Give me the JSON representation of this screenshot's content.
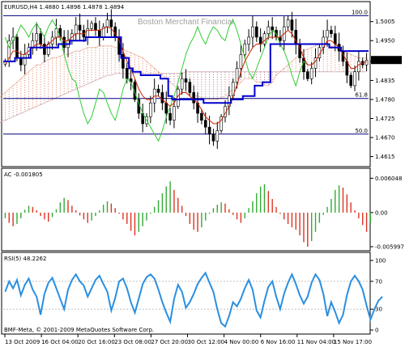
{
  "window": {
    "symbol_header": "EURUSD,H4  1.4880 1.4896 1.4878 1.4894",
    "watermark": "Boston Merchant Financial",
    "footer": "BMF-Meta, © 2001-2009 MetaQuotes Software Corp."
  },
  "colors": {
    "candle": "#000000",
    "kijun": "#0000cc",
    "tenkan": "#cc2200",
    "chikou": "#33cc33",
    "cloud": "#e08060",
    "cloud_shade": "#b07080",
    "fib": "#000080",
    "ac_up": "#33aa33",
    "ac_down": "#dd3322",
    "rsi": "#2a8fe0",
    "grid": "#c0c0c0"
  },
  "chart_data": [
    {
      "type": "candlestick",
      "title": "EURUSD,H4",
      "ohlc_last": {
        "open": 1.488,
        "high": 1.4896,
        "low": 1.4878,
        "close": 1.4894
      },
      "y_ticks": [
        "1.5005",
        "1.4950",
        "1.4890",
        "1.4835",
        "1.4780",
        "1.4725",
        "1.4670",
        "1.4615"
      ],
      "ylim": [
        1.46,
        1.503
      ],
      "current_price": "1.4894",
      "fib_levels": [
        {
          "label": "100.0",
          "value": 1.5022
        },
        {
          "label": "61.8",
          "value": 1.4783
        },
        {
          "label": "50.0",
          "value": 1.468
        }
      ],
      "close": [
        1.489,
        1.495,
        1.496,
        1.49,
        1.488,
        1.491,
        1.493,
        1.495,
        1.497,
        1.494,
        1.491,
        1.494,
        1.496,
        1.4985,
        1.496,
        1.493,
        1.495,
        1.497,
        1.4995,
        1.498,
        1.496,
        1.4985,
        1.5,
        1.498,
        1.496,
        1.499,
        1.501,
        1.499,
        1.496,
        1.491,
        1.487,
        1.484,
        1.483,
        1.478,
        1.474,
        1.471,
        1.473,
        1.477,
        1.481,
        1.48,
        1.477,
        1.474,
        1.472,
        1.476,
        1.481,
        1.484,
        1.483,
        1.48,
        1.477,
        1.474,
        1.472,
        1.47,
        1.468,
        1.466,
        1.469,
        1.473,
        1.476,
        1.479,
        1.483,
        1.487,
        1.491,
        1.494,
        1.496,
        1.499,
        1.496,
        1.494,
        1.497,
        1.499,
        1.498,
        1.496,
        1.495,
        1.499,
        1.501,
        1.498,
        1.494,
        1.49,
        1.486,
        1.484,
        1.487,
        1.49,
        1.493,
        1.496,
        1.498,
        1.497,
        1.494,
        1.492,
        1.489,
        1.485,
        1.482,
        1.486,
        1.489,
        1.488,
        1.4894
      ],
      "kijun": [
        1.489,
        1.489,
        1.489,
        1.49,
        1.49,
        1.49,
        1.49,
        1.493,
        1.493,
        1.493,
        1.493,
        1.493,
        1.493,
        1.493,
        1.494,
        1.494,
        1.494,
        1.495,
        1.495,
        1.495,
        1.495,
        1.496,
        1.496,
        1.496,
        1.496,
        1.496,
        1.496,
        1.496,
        1.496,
        1.496,
        1.49,
        1.49,
        1.487,
        1.486,
        1.486,
        1.485,
        1.485,
        1.485,
        1.485,
        1.485,
        1.484,
        1.484,
        1.479,
        1.478,
        1.478,
        1.478,
        1.478,
        1.478,
        1.478,
        1.478,
        1.478,
        1.477,
        1.477,
        1.477,
        1.477,
        1.477,
        1.477,
        1.477,
        1.478,
        1.478,
        1.478,
        1.479,
        1.479,
        1.479,
        1.482,
        1.482,
        1.483,
        1.483,
        1.494,
        1.494,
        1.494,
        1.494,
        1.494,
        1.494,
        1.494,
        1.494,
        1.494,
        1.494,
        1.494,
        1.494,
        1.494,
        1.494,
        1.494,
        1.493,
        1.493,
        1.493,
        1.492,
        1.492,
        1.492,
        1.492,
        1.492,
        1.492,
        1.492
      ],
      "tenkan": [
        1.488,
        1.49,
        1.492,
        1.492,
        1.491,
        1.491,
        1.492,
        1.493,
        1.494,
        1.494,
        1.493,
        1.494,
        1.495,
        1.496,
        1.496,
        1.495,
        1.495,
        1.496,
        1.497,
        1.497,
        1.497,
        1.498,
        1.498,
        1.498,
        1.498,
        1.4985,
        1.499,
        1.4985,
        1.497,
        1.495,
        1.492,
        1.489,
        1.487,
        1.484,
        1.481,
        1.479,
        1.478,
        1.478,
        1.479,
        1.479,
        1.478,
        1.477,
        1.476,
        1.477,
        1.479,
        1.48,
        1.48,
        1.479,
        1.478,
        1.477,
        1.475,
        1.473,
        1.472,
        1.471,
        1.471,
        1.472,
        1.474,
        1.476,
        1.479,
        1.482,
        1.486,
        1.489,
        1.491,
        1.493,
        1.494,
        1.494,
        1.495,
        1.496,
        1.496,
        1.496,
        1.496,
        1.497,
        1.498,
        1.497,
        1.495,
        1.493,
        1.49,
        1.488,
        1.488,
        1.489,
        1.491,
        1.493,
        1.495,
        1.495,
        1.494,
        1.493,
        1.491,
        1.489,
        1.487,
        1.487,
        1.488,
        1.4885,
        1.489
      ],
      "chikou": [
        1.496,
        1.493,
        1.495,
        1.497,
        1.4995,
        1.498,
        1.496,
        1.4985,
        1.5,
        1.498,
        1.496,
        1.499,
        1.501,
        1.499,
        1.496,
        1.491,
        1.487,
        1.484,
        1.483,
        1.478,
        1.474,
        1.471,
        1.473,
        1.477,
        1.481,
        1.48,
        1.477,
        1.474,
        1.472,
        1.476,
        1.481,
        1.484,
        1.483,
        1.48,
        1.477,
        1.474,
        1.472,
        1.47,
        1.468,
        1.466,
        1.469,
        1.473,
        1.476,
        1.479,
        1.483,
        1.487,
        1.491,
        1.494,
        1.496,
        1.499,
        1.496,
        1.494,
        1.497,
        1.499,
        1.498,
        1.496,
        1.495,
        1.499,
        1.501,
        1.498,
        1.494,
        1.49,
        1.486,
        1.484,
        1.487,
        1.49,
        1.493,
        1.496,
        1.498,
        1.497,
        1.494,
        1.492,
        1.489,
        1.485,
        1.482,
        1.486,
        1.489,
        1.488
      ],
      "cloud_a": [
        1.476,
        1.477,
        1.478,
        1.479,
        1.48,
        1.481,
        1.482,
        1.483,
        1.484,
        1.485,
        1.486,
        1.487,
        1.488,
        1.488,
        1.489,
        1.4895,
        1.49,
        1.49,
        1.4905,
        1.491,
        1.491,
        1.4915,
        1.492,
        1.492,
        1.4925,
        1.493,
        1.493,
        1.493,
        1.4935,
        1.4935,
        1.4935,
        1.4935,
        1.493,
        1.493,
        1.4925,
        1.492,
        1.4915,
        1.491,
        1.4905,
        1.49,
        1.489,
        1.488,
        1.487,
        1.486,
        1.485,
        1.484,
        1.483,
        1.482,
        1.481,
        1.48,
        1.48,
        1.4795,
        1.479,
        1.479,
        1.4785,
        1.478,
        1.478,
        1.478,
        1.478,
        1.4785,
        1.479,
        1.48,
        1.481,
        1.482,
        1.483,
        1.484,
        1.484,
        1.484,
        1.483,
        1.483,
        1.482,
        1.482,
        1.483,
        1.485,
        1.486,
        1.487,
        1.488,
        1.489,
        1.49,
        1.491,
        1.492,
        1.4925,
        1.493,
        1.4935,
        1.494,
        1.494,
        1.494,
        1.4935,
        1.493,
        1.4925,
        1.492,
        1.4915,
        1.491,
        1.4905,
        1.49,
        1.49,
        1.49
      ],
      "cloud_b": [
        1.47,
        1.4705,
        1.471,
        1.4715,
        1.472,
        1.4725,
        1.473,
        1.4735,
        1.474,
        1.4745,
        1.475,
        1.4755,
        1.476,
        1.4765,
        1.477,
        1.4775,
        1.478,
        1.4785,
        1.479,
        1.4795,
        1.48,
        1.4805,
        1.481,
        1.4815,
        1.482,
        1.4825,
        1.483,
        1.4835,
        1.484,
        1.4845,
        1.485,
        1.485,
        1.4855,
        1.4855,
        1.4855,
        1.4855,
        1.4855,
        1.4855,
        1.4855,
        1.4855,
        1.4855,
        1.4855,
        1.4855,
        1.4855,
        1.4855,
        1.4855,
        1.4855,
        1.4855,
        1.4855,
        1.4855,
        1.486,
        1.486,
        1.486,
        1.486,
        1.486,
        1.486,
        1.486,
        1.486,
        1.486,
        1.486,
        1.486,
        1.486,
        1.486,
        1.486,
        1.486,
        1.486,
        1.486,
        1.486,
        1.486,
        1.486,
        1.486,
        1.486,
        1.486,
        1.486,
        1.486,
        1.486,
        1.486,
        1.486,
        1.486,
        1.486,
        1.486,
        1.486,
        1.486,
        1.486,
        1.486,
        1.486,
        1.486,
        1.486,
        1.486,
        1.486,
        1.486,
        1.486,
        1.486,
        1.486,
        1.486,
        1.486,
        1.486
      ]
    },
    {
      "type": "bar",
      "title": "AC -0.001805",
      "y_ticks": [
        "0.006048",
        "0.00",
        "-0.005997"
      ],
      "ylim": [
        -0.006,
        0.0061
      ],
      "values": [
        -0.001,
        -0.0018,
        -0.0024,
        -0.002,
        -0.001,
        0.0005,
        0.0012,
        0.001,
        0.0004,
        -0.0006,
        -0.0012,
        -0.0016,
        -0.0008,
        0.0006,
        0.0018,
        0.0026,
        0.0022,
        0.0012,
        0.0004,
        -0.0005,
        -0.0012,
        -0.0018,
        -0.0014,
        -0.0006,
        0.0004,
        0.0014,
        0.002,
        0.0016,
        0.0008,
        -0.0002,
        -0.0012,
        -0.002,
        -0.0032,
        -0.004,
        -0.0034,
        -0.0024,
        -0.0014,
        -0.0002,
        0.001,
        0.0022,
        0.0034,
        0.0046,
        0.0055,
        0.004,
        0.0026,
        0.0012,
        -0.0006,
        -0.002,
        -0.003,
        -0.0034,
        -0.0026,
        -0.0014,
        -0.0002,
        0.0008,
        0.0014,
        0.0018,
        0.0016,
        0.0006,
        -0.0004,
        -0.0012,
        -0.0018,
        -0.001,
        0.0008,
        0.002,
        0.0034,
        0.0046,
        0.005,
        0.0038,
        0.0024,
        0.001,
        -0.0002,
        -0.0012,
        -0.002,
        -0.0026,
        -0.003,
        -0.004,
        -0.0052,
        -0.006,
        -0.005,
        -0.0034,
        -0.0018,
        -0.0004,
        0.001,
        0.0024,
        0.004,
        0.0048,
        0.0044,
        0.0032,
        0.0018,
        0.0004,
        -0.001,
        -0.0022,
        -0.0034,
        -0.0018
      ]
    },
    {
      "type": "line",
      "title": "RSI(5) 48.2262",
      "y_ticks": [
        "100",
        "70",
        "30",
        "0"
      ],
      "ylim": [
        0,
        100
      ],
      "series": [
        {
          "name": "RSI(5)",
          "values": [
            55,
            70,
            60,
            72,
            50,
            65,
            74,
            58,
            48,
            22,
            52,
            68,
            75,
            60,
            45,
            30,
            58,
            72,
            80,
            70,
            64,
            48,
            60,
            72,
            78,
            66,
            55,
            28,
            46,
            70,
            74,
            60,
            40,
            25,
            45,
            66,
            76,
            80,
            74,
            58,
            40,
            25,
            12,
            45,
            65,
            55,
            32,
            40,
            52,
            66,
            75,
            82,
            68,
            55,
            30,
            10,
            5,
            20,
            40,
            34,
            45,
            60,
            72,
            58,
            28,
            18,
            42,
            62,
            70,
            48,
            30,
            52,
            68,
            80,
            66,
            50,
            38,
            48,
            68,
            80,
            72,
            52,
            20,
            40,
            26,
            10,
            22,
            50,
            70,
            78,
            70,
            58,
            35,
            15,
            30,
            42,
            48
          ]
        }
      ],
      "x_tick_labels": [
        "13 Oct 2009",
        "16 Oct 04:00",
        "20 Oct 16:00",
        "23 Oct 08:00",
        "27 Oct 20:00",
        "30 Oct 12:00",
        "4 Nov 00:00",
        "6 Nov 16:00",
        "11 Nov 04:00",
        "15 Nov 17:00"
      ]
    }
  ]
}
